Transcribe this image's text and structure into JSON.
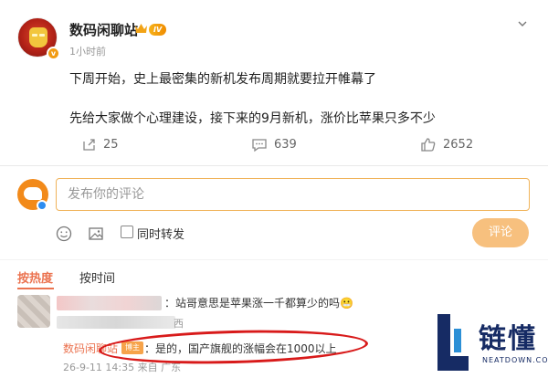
{
  "post": {
    "username": "数码闲聊站",
    "level_badge": "IV",
    "time": "1小时前",
    "lines": [
      "下周开始，史上最密集的新机发布周期就要拉开帷幕了",
      "先给大家做个心理建设，接下来的9月新机，涨价比苹果只多不少"
    ],
    "actions": {
      "repost_count": "25",
      "comment_count": "639",
      "like_count": "2652"
    }
  },
  "composer": {
    "placeholder": "发布你的评论",
    "repost_label": "同时转发",
    "submit_label": "评论"
  },
  "comments": {
    "tabs": [
      "按热度",
      "按时间"
    ],
    "first": {
      "text": "：站哥意思是苹果涨一千都算少的吗😬",
      "meta_tail": "西"
    },
    "reply": {
      "name": "数码闲聊站",
      "tag": "博主",
      "text": "：是的，国产旗舰的涨幅会在1000以上",
      "meta": "26-9-11 14:35 来自 广东"
    }
  },
  "watermark": {
    "brand": "链懂",
    "sub": "NEATDOWN.COM"
  },
  "colors": {
    "accent": "#eb7350",
    "tab_active": "#eb7350",
    "submit": "#f7c07e",
    "highlight": "#d81a1a"
  }
}
